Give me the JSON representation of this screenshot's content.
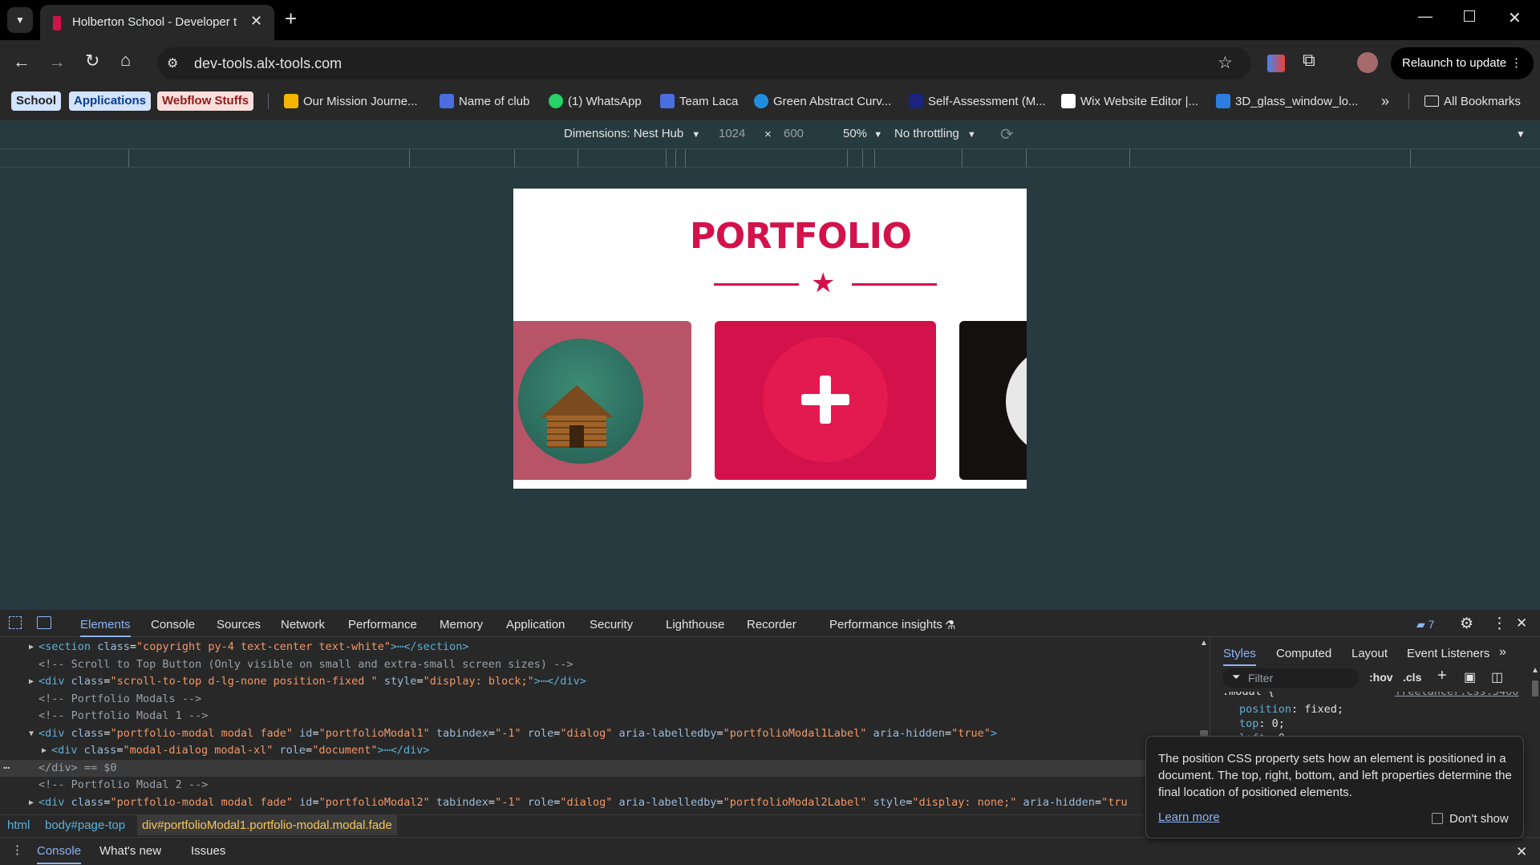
{
  "browser": {
    "tab_title": "Holberton School - Developer t",
    "url": "dev-tools.alx-tools.com",
    "relaunch_label": "Relaunch to update"
  },
  "bookmarks": {
    "chips": [
      {
        "label": "School",
        "bg": "#d2e3fc",
        "fg": "#1f1f1f"
      },
      {
        "label": "Applications",
        "bg": "#d3e3fd",
        "fg": "#0b3d91"
      },
      {
        "label": "Webflow Stuffs",
        "bg": "#f9dedc",
        "fg": "#8c1d18"
      }
    ],
    "items": [
      {
        "label": "Our Mission Journe...",
        "icon": "slides-icon",
        "color": "#f4b400"
      },
      {
        "label": "Name of club",
        "icon": "forms-icon",
        "color": "#4a6ee0"
      },
      {
        "label": "(1) WhatsApp",
        "icon": "whatsapp-icon",
        "color": "#25d366"
      },
      {
        "label": "Team Laca",
        "icon": "forms-icon",
        "color": "#4a6ee0"
      },
      {
        "label": "Green Abstract Curv...",
        "icon": "canva-icon",
        "color": "#1f8ee0"
      },
      {
        "label": "Self-Assessment (M...",
        "icon": "doc-icon",
        "color": "#1a237e"
      },
      {
        "label": "Wix Website Editor |...",
        "icon": "wix-icon",
        "color": "#ffffff"
      },
      {
        "label": "3D_glass_window_lo...",
        "icon": "image-icon",
        "color": "#2d7de0"
      }
    ],
    "all_label": "All Bookmarks"
  },
  "device_toolbar": {
    "dimensions_label": "Dimensions: Nest Hub",
    "width": "1024",
    "times": "×",
    "height": "600",
    "zoom": "50%",
    "throttling": "No throttling"
  },
  "page": {
    "heading": "PORTFOLIO",
    "accent": "#d3114a"
  },
  "devtools": {
    "tabs": [
      "Elements",
      "Console",
      "Sources",
      "Network",
      "Performance",
      "Memory",
      "Application",
      "Security",
      "Lighthouse",
      "Recorder",
      "Performance insights"
    ],
    "issues_count": "7",
    "styles_tabs": [
      "Styles",
      "Computed",
      "Layout",
      "Event Listeners"
    ],
    "filter_placeholder": "Filter",
    "hov": ":hov",
    "cls": ".cls",
    "css_source": "freelancer.css:5460",
    "css_selector": ".modal {",
    "css_props": [
      {
        "name": "position",
        "value": "fixed;"
      },
      {
        "name": "top",
        "value": "0;"
      },
      {
        "name": "left",
        "value": "0;"
      }
    ],
    "dom_lines": [
      {
        "pre": "<",
        "tag": "section",
        "attrs": [
          {
            "n": "class",
            "v": "\"copyright py-4 text-center text-white\""
          }
        ],
        "post": ">⋯</section>",
        "arrow": "▶",
        "type": "el"
      },
      {
        "text": "<!-- Scroll to Top Button (Only visible on small and extra-small screen sizes) -->",
        "type": "cmt"
      },
      {
        "pre": "<",
        "tag": "div",
        "attrs": [
          {
            "n": "class",
            "v": "\"scroll-to-top d-lg-none position-fixed \""
          },
          {
            "n": "style",
            "v": "\"display: block;\""
          }
        ],
        "post": ">⋯</div>",
        "arrow": "▶",
        "type": "el"
      },
      {
        "text": "<!-- Portfolio Modals -->",
        "type": "cmt"
      },
      {
        "text": "<!-- Portfolio Modal 1 -->",
        "type": "cmt"
      },
      {
        "pre": "<",
        "tag": "div",
        "attrs": [
          {
            "n": "class",
            "v": "\"portfolio-modal modal fade\""
          },
          {
            "n": "id",
            "v": "\"portfolioModal1\""
          },
          {
            "n": "tabindex",
            "v": "\"-1\""
          },
          {
            "n": "role",
            "v": "\"dialog\""
          },
          {
            "n": "aria-labelledby",
            "v": "\"portfolioModal1Label\""
          },
          {
            "n": "aria-hidden",
            "v": "\"true\""
          }
        ],
        "post": ">",
        "arrow": "▼",
        "type": "el"
      },
      {
        "pre": "<",
        "tag": "div",
        "attrs": [
          {
            "n": "class",
            "v": "\"modal-dialog modal-xl\""
          },
          {
            "n": "role",
            "v": "\"document\""
          }
        ],
        "post": ">⋯</div>",
        "arrow": "▶",
        "type": "el",
        "indent": 1
      },
      {
        "text": "</div> == $0",
        "type": "sel"
      },
      {
        "text": "<!-- Portfolio Modal 2 -->",
        "type": "cmt"
      },
      {
        "pre": "<",
        "tag": "div",
        "attrs": [
          {
            "n": "class",
            "v": "\"portfolio-modal modal fade\""
          },
          {
            "n": "id",
            "v": "\"portfolioModal2\""
          },
          {
            "n": "tabindex",
            "v": "\"-1\""
          },
          {
            "n": "role",
            "v": "\"dialog\""
          },
          {
            "n": "aria-labelledby",
            "v": "\"portfolioModal2Label\""
          },
          {
            "n": "style",
            "v": "\"display: none;\""
          },
          {
            "n": "aria-hidden",
            "v": "\"tru"
          }
        ],
        "post": "",
        "arrow": "▶",
        "type": "el"
      }
    ],
    "breadcrumbs": [
      "html",
      "body#page-top",
      "div#portfolioModal1.portfolio-modal.modal.fade"
    ],
    "tooltip": {
      "text": "The position CSS property sets how an element is positioned in a document. The top, right, bottom, and left properties determine the final location of positioned elements.",
      "learn_more": "Learn more",
      "dont_show": "Don't show"
    },
    "drawer_tabs": [
      "Console",
      "What's new",
      "Issues"
    ]
  }
}
